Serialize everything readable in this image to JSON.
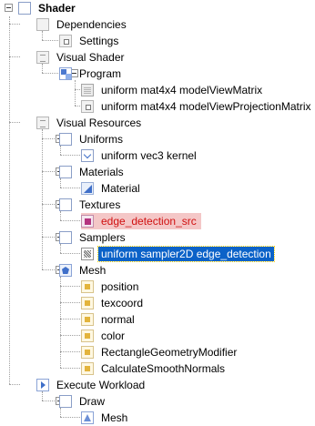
{
  "tree": {
    "root": "Shader",
    "dependencies": "Dependencies",
    "settings": "Settings",
    "visual_shader": "Visual Shader",
    "program": "Program",
    "model_view_matrix": "uniform mat4x4 modelViewMatrix",
    "model_view_projection_matrix": "uniform mat4x4 modelViewProjectionMatrix",
    "visual_resources": "Visual Resources",
    "uniforms": "Uniforms",
    "kernel": "uniform vec3 kernel",
    "materials": "Materials",
    "material": "Material",
    "textures": "Textures",
    "edge_detection_src": "edge_detection_src",
    "samplers": "Samplers",
    "sampler_edge_detection": "uniform sampler2D edge_detection",
    "mesh": "Mesh",
    "position": "position",
    "texcoord": "texcoord",
    "normal": "normal",
    "color": "color",
    "rectangle_geometry_modifier": "RectangleGeometryModifier",
    "calculate_smooth_normals": "CalculateSmoothNormals",
    "execute_workload": "Execute Workload",
    "draw": "Draw",
    "draw_mesh": "Mesh"
  },
  "colors": {
    "selection": "#0b62c8",
    "error_text": "#d01010",
    "error_background": "#f4c7c7"
  }
}
